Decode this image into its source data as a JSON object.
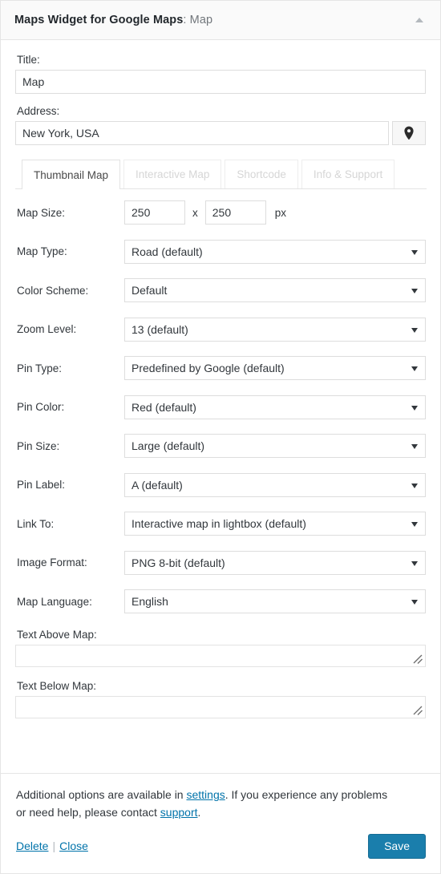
{
  "header": {
    "title_main": "Maps Widget for Google Maps",
    "title_instance": ": Map",
    "toggle_icon": "caret-up-icon"
  },
  "title_field": {
    "label": "Title:",
    "value": "Map",
    "placeholder": ""
  },
  "address_field": {
    "label": "Address:",
    "value": "New York, USA",
    "placeholder": "",
    "pin_icon": "map-pin-icon"
  },
  "tabs": [
    {
      "label": "Thumbnail Map",
      "active": true
    },
    {
      "label": "Interactive Map",
      "active": false
    },
    {
      "label": "Shortcode",
      "active": false
    },
    {
      "label": "Info & Support",
      "active": false
    }
  ],
  "map_size": {
    "label": "Map Size:",
    "width": "250",
    "separator": "x",
    "height": "250",
    "unit": "px"
  },
  "selects": [
    {
      "label": "Map Type:",
      "value": "Road (default)"
    },
    {
      "label": "Color Scheme:",
      "value": "Default"
    },
    {
      "label": "Zoom Level:",
      "value": "13 (default)"
    },
    {
      "label": "Pin Type:",
      "value": "Predefined by Google (default)"
    },
    {
      "label": "Pin Color:",
      "value": "Red (default)"
    },
    {
      "label": "Pin Size:",
      "value": "Large (default)"
    },
    {
      "label": "Pin Label:",
      "value": "A (default)"
    },
    {
      "label": "Link To:",
      "value": "Interactive map in lightbox (default)"
    },
    {
      "label": "Image Format:",
      "value": "PNG 8-bit (default)"
    },
    {
      "label": "Map Language:",
      "value": "English"
    }
  ],
  "text_above": {
    "label": "Text Above Map:",
    "value": ""
  },
  "text_below": {
    "label": "Text Below Map:",
    "value": ""
  },
  "footer": {
    "note_part1": "Additional options are available in ",
    "settings_link": "settings",
    "note_part2": ". If you experience any problems or need help, please contact ",
    "support_link": "support",
    "note_part3": ".",
    "delete_label": "Delete",
    "separator": "|",
    "close_label": "Close",
    "save_label": "Save"
  },
  "colors": {
    "link": "#0073aa",
    "save_button": "#1a7eac",
    "border": "#e5e5e5",
    "text": "#32373c"
  }
}
